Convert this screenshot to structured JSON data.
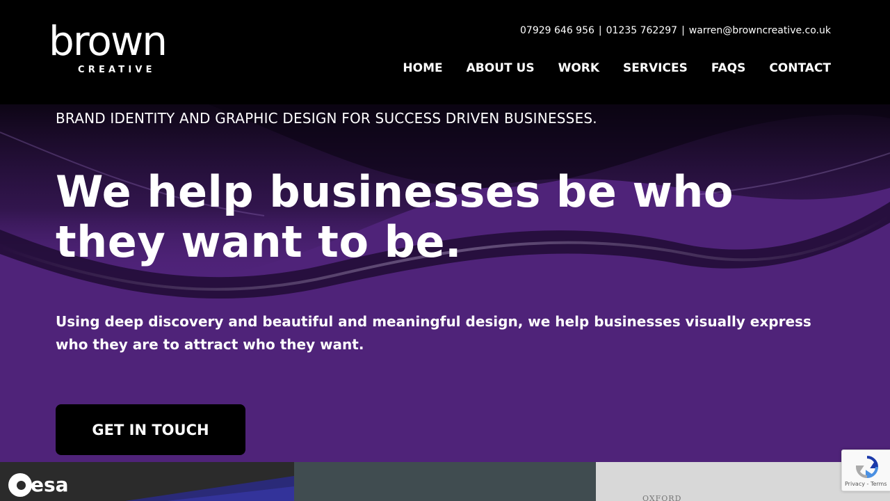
{
  "header": {
    "logo": {
      "word": "brown",
      "sub": "CREATIVE"
    },
    "contact": {
      "phone1": "07929 646 956",
      "separator": "|",
      "phone2": "01235 762297",
      "email": "warren@browncreative.co.uk"
    },
    "nav": [
      {
        "label": "HOME"
      },
      {
        "label": "ABOUT US"
      },
      {
        "label": "WORK"
      },
      {
        "label": "SERVICES"
      },
      {
        "label": "FAQS"
      },
      {
        "label": "CONTACT"
      }
    ]
  },
  "hero": {
    "tagline": "BRAND IDENTITY AND GRAPHIC DESIGN FOR SUCCESS DRIVEN BUSINESSES.",
    "headline": "We help businesses be who they want to be.",
    "intro": "Using deep discovery and beautiful and meaningful design, we help businesses visually express who they are to attract who they want.",
    "cta_label": "GET IN TOUCH",
    "background_color": "#4f2379"
  },
  "portfolio": {
    "tile1_logo": "esa",
    "tile3_text": "OXFORD"
  },
  "recaptcha": {
    "links": "Privacy - Terms",
    "icon": "recaptcha-icon"
  }
}
